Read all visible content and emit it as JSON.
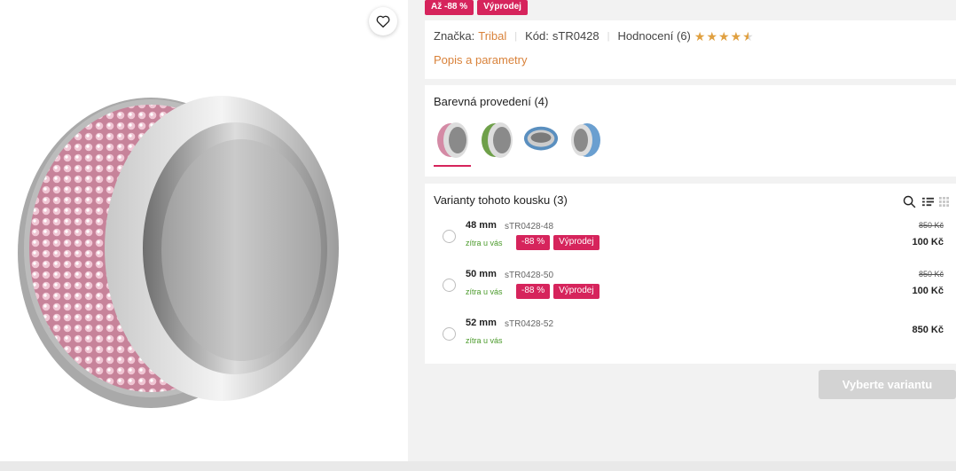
{
  "badges": [
    "Až -88 %",
    "Výprodej"
  ],
  "info": {
    "brand_label": "Značka:",
    "brand_value": "Tribal",
    "code_label": "Kód:",
    "code_value": "sTR0428",
    "rating_label": "Hodnocení (6)",
    "rating_value": 4.5,
    "rating_max": 5,
    "description_link": "Popis a parametry"
  },
  "colors": {
    "title": "Barevná provedení (4)",
    "swatches": [
      {
        "name": "pink",
        "color": "#d48aa5",
        "selected": true
      },
      {
        "name": "green",
        "color": "#6fa04a",
        "selected": false
      },
      {
        "name": "blue",
        "color": "#5a8fbf",
        "selected": false
      },
      {
        "name": "light-blue",
        "color": "#6a9fd0",
        "selected": false
      }
    ]
  },
  "variants": {
    "title": "Varianty tohoto kousku (3)",
    "items": [
      {
        "size": "48 mm",
        "code": "sTR0428-48",
        "delivery": "zítra u vás",
        "discount": "-88 %",
        "sale": "Výprodej",
        "old_price": "850 Kč",
        "price": "100 Kč"
      },
      {
        "size": "50 mm",
        "code": "sTR0428-50",
        "delivery": "zítra u vás",
        "discount": "-88 %",
        "sale": "Výprodej",
        "old_price": "850 Kč",
        "price": "100 Kč"
      },
      {
        "size": "52 mm",
        "code": "sTR0428-52",
        "delivery": "zítra u vás",
        "discount": "",
        "sale": "",
        "old_price": "",
        "price": "850 Kč"
      }
    ]
  },
  "cta_label": "Vyberte variantu",
  "accent_color": "#d6245c",
  "link_color": "#d9823a"
}
